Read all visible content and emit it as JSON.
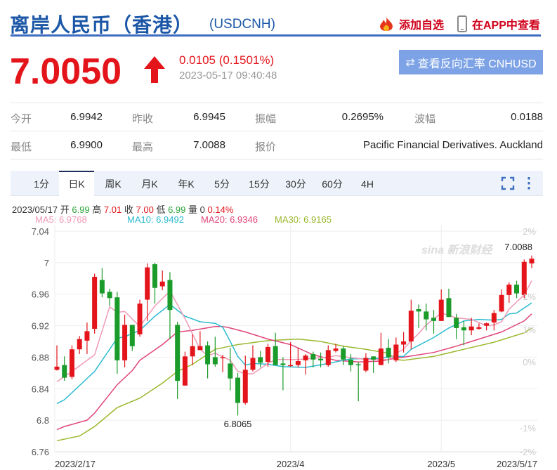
{
  "header": {
    "title": "离岸人民币（香港）",
    "code": "(USDCNH)",
    "add_watch": "添加自选",
    "view_app": "在APP中查看"
  },
  "quote": {
    "price": "7.0050",
    "change": "0.0105 (0.1501%)",
    "time": "2023-05-17 09:40:48",
    "reverse_button": "查看反向汇率 CNHUSD"
  },
  "stats": [
    [
      {
        "label": "今开",
        "value": "6.9942"
      },
      {
        "label": "昨收",
        "value": "6.9945"
      },
      {
        "label": "振幅",
        "value": "0.2695%"
      },
      {
        "label": "波幅",
        "value": "0.0188"
      }
    ],
    [
      {
        "label": "最低",
        "value": "6.9900"
      },
      {
        "label": "最高",
        "value": "7.0088"
      },
      {
        "label": "报价",
        "value": "Pacific Financial Derivatives. Auckland"
      }
    ]
  ],
  "tabs": [
    "1分",
    "日K",
    "周K",
    "月K",
    "年K",
    "5分",
    "15分",
    "30分",
    "60分",
    "4H"
  ],
  "active_tab": "日K",
  "info": {
    "date": "2023/05/17",
    "open_label": "开",
    "open": "6.99",
    "high_label": "高",
    "high": "7.01",
    "close_label": "收",
    "close": "7.00",
    "low_label": "低",
    "low": "6.99",
    "vol_label": "量",
    "vol": "0",
    "pct": "0.14%"
  },
  "ma": {
    "ma5": "MA5: 6.9768",
    "ma10": "MA10: 6.9492",
    "ma20": "MA20: 6.9346",
    "ma30": "MA30: 6.9165"
  },
  "colors": {
    "up": "#e4141b",
    "down": "#1a9b2a",
    "ma5": "#f09ab6",
    "ma10": "#2bbbd0",
    "ma20": "#e0457b",
    "ma30": "#9ab82e"
  },
  "watermark": "sina 新浪财经",
  "chart_data": {
    "type": "candlestick",
    "ylim": [
      6.76,
      7.04
    ],
    "yticks": [
      "7.04",
      "7",
      "6.96",
      "6.92",
      "6.88",
      "6.84",
      "6.8",
      "6.76"
    ],
    "pct_ticks": [
      "2%",
      "1%",
      "1%",
      "0%",
      "-1%",
      "-2%"
    ],
    "xlabels": [
      {
        "idx": 0,
        "label": "2023/2/17"
      },
      {
        "idx": 31,
        "label": "2023/4"
      },
      {
        "idx": 51,
        "label": "2023/5"
      },
      {
        "idx": 63,
        "label": "2023/5/17"
      }
    ],
    "annotations": [
      {
        "idx": 24,
        "price": 6.8065,
        "label": "6.8065"
      },
      {
        "idx": 63,
        "price": 7.0088,
        "label": "7.0088"
      }
    ],
    "ohlc": [
      [
        6.864,
        6.895,
        6.863,
        6.868
      ],
      [
        6.87,
        6.881,
        6.85,
        6.854
      ],
      [
        6.855,
        6.895,
        6.852,
        6.89
      ],
      [
        6.89,
        6.907,
        6.884,
        6.903
      ],
      [
        6.901,
        6.924,
        6.884,
        6.913
      ],
      [
        6.916,
        6.986,
        6.91,
        6.982
      ],
      [
        6.978,
        6.993,
        6.956,
        6.961
      ],
      [
        6.963,
        6.967,
        6.945,
        6.955
      ],
      [
        6.956,
        6.963,
        6.859,
        6.876
      ],
      [
        6.876,
        6.934,
        6.867,
        6.921
      ],
      [
        6.921,
        6.921,
        6.888,
        6.894
      ],
      [
        6.909,
        6.953,
        6.906,
        6.948
      ],
      [
        6.953,
        6.999,
        6.926,
        6.994
      ],
      [
        6.998,
        7.0,
        6.948,
        6.968
      ],
      [
        6.97,
        6.99,
        6.965,
        6.976
      ],
      [
        6.978,
        6.988,
        6.903,
        6.94
      ],
      [
        6.921,
        6.925,
        6.827,
        6.85
      ],
      [
        6.844,
        6.887,
        6.844,
        6.881
      ],
      [
        6.881,
        6.909,
        6.87,
        6.894
      ],
      [
        6.889,
        6.913,
        6.889,
        6.894
      ],
      [
        6.895,
        6.9,
        6.853,
        6.871
      ],
      [
        6.88,
        6.906,
        6.868,
        6.871
      ],
      [
        6.879,
        6.883,
        6.861,
        6.88
      ],
      [
        6.872,
        6.892,
        6.838,
        6.853
      ],
      [
        6.854,
        6.86,
        6.806,
        6.822
      ],
      [
        6.822,
        6.882,
        6.82,
        6.864
      ],
      [
        6.864,
        6.895,
        6.862,
        6.879
      ],
      [
        6.88,
        6.888,
        6.867,
        6.873
      ],
      [
        6.874,
        6.897,
        6.868,
        6.893
      ],
      [
        6.894,
        6.911,
        6.87,
        6.87
      ],
      [
        6.872,
        6.88,
        6.838,
        6.87
      ],
      [
        6.869,
        6.899,
        6.868,
        6.87
      ],
      [
        6.87,
        6.892,
        6.867,
        6.875
      ],
      [
        6.876,
        6.884,
        6.858,
        6.882
      ],
      [
        6.884,
        6.887,
        6.867,
        6.877
      ],
      [
        6.878,
        6.886,
        6.867,
        6.876
      ],
      [
        6.87,
        6.895,
        6.868,
        6.889
      ],
      [
        6.888,
        6.897,
        6.886,
        6.891
      ],
      [
        6.891,
        6.894,
        6.87,
        6.877
      ],
      [
        6.877,
        6.884,
        6.862,
        6.87
      ],
      [
        6.871,
        6.874,
        6.824,
        6.87
      ],
      [
        6.863,
        6.885,
        6.861,
        6.879
      ],
      [
        6.881,
        6.881,
        6.86,
        6.877
      ],
      [
        6.87,
        6.911,
        6.87,
        6.891
      ],
      [
        6.892,
        6.903,
        6.872,
        6.88
      ],
      [
        6.876,
        6.905,
        6.874,
        6.896
      ],
      [
        6.896,
        6.912,
        6.886,
        6.9
      ],
      [
        6.9,
        6.953,
        6.89,
        6.939
      ],
      [
        6.941,
        6.947,
        6.917,
        6.938
      ],
      [
        6.938,
        6.948,
        6.914,
        6.928
      ],
      [
        6.93,
        6.94,
        6.91,
        6.926
      ],
      [
        6.926,
        6.966,
        6.926,
        6.953
      ],
      [
        6.955,
        6.967,
        6.931,
        6.931
      ],
      [
        6.93,
        6.935,
        6.903,
        6.917
      ],
      [
        6.918,
        6.926,
        6.895,
        6.914
      ],
      [
        6.914,
        6.93,
        6.908,
        6.919
      ],
      [
        6.916,
        6.923,
        6.915,
        6.918
      ],
      [
        6.92,
        6.924,
        6.914,
        6.923
      ],
      [
        6.924,
        6.94,
        6.914,
        6.936
      ],
      [
        6.938,
        6.966,
        6.937,
        6.959
      ],
      [
        6.959,
        6.975,
        6.949,
        6.972
      ],
      [
        6.972,
        6.977,
        6.955,
        6.961
      ],
      [
        6.959,
        7.004,
        6.955,
        7.001
      ],
      [
        6.999,
        7.009,
        6.993,
        7.005
      ]
    ],
    "ma_series": {
      "ma5": [
        [
          0,
          6.849
        ],
        [
          2,
          6.862
        ],
        [
          5,
          6.883
        ],
        [
          7,
          6.944
        ],
        [
          8,
          6.937
        ],
        [
          9,
          6.938
        ],
        [
          11,
          6.919
        ],
        [
          13,
          6.945
        ],
        [
          15,
          6.964
        ],
        [
          17,
          6.929
        ],
        [
          19,
          6.89
        ],
        [
          20,
          6.882
        ],
        [
          21,
          6.885
        ],
        [
          23,
          6.876
        ],
        [
          24,
          6.862
        ],
        [
          25,
          6.859
        ],
        [
          26,
          6.859
        ],
        [
          28,
          6.872
        ],
        [
          29,
          6.877
        ],
        [
          32,
          6.877
        ],
        [
          36,
          6.88
        ],
        [
          37,
          6.882
        ],
        [
          41,
          6.877
        ],
        [
          44,
          6.877
        ],
        [
          45,
          6.885
        ],
        [
          46,
          6.89
        ],
        [
          47,
          6.901
        ],
        [
          48,
          6.91
        ],
        [
          49,
          6.921
        ],
        [
          51,
          6.936
        ],
        [
          53,
          6.93
        ],
        [
          55,
          6.928
        ],
        [
          57,
          6.92
        ],
        [
          58,
          6.921
        ],
        [
          59,
          6.925
        ],
        [
          60,
          6.941
        ],
        [
          61,
          6.95
        ],
        [
          62,
          6.959
        ],
        [
          63,
          6.977
        ]
      ],
      "ma10": [
        [
          0,
          6.821
        ],
        [
          1,
          6.826
        ],
        [
          5,
          6.862
        ],
        [
          8,
          6.904
        ],
        [
          9,
          6.906
        ],
        [
          11,
          6.914
        ],
        [
          13,
          6.932
        ],
        [
          15,
          6.947
        ],
        [
          17,
          6.932
        ],
        [
          19,
          6.925
        ],
        [
          21,
          6.923
        ],
        [
          22,
          6.918
        ],
        [
          23,
          6.9
        ],
        [
          24,
          6.881
        ],
        [
          25,
          6.87
        ],
        [
          26,
          6.872
        ],
        [
          28,
          6.871
        ],
        [
          30,
          6.868
        ],
        [
          33,
          6.867
        ],
        [
          36,
          6.872
        ],
        [
          39,
          6.878
        ],
        [
          42,
          6.878
        ],
        [
          45,
          6.881
        ],
        [
          46,
          6.881
        ],
        [
          47,
          6.89
        ],
        [
          50,
          6.905
        ],
        [
          52,
          6.917
        ],
        [
          54,
          6.926
        ],
        [
          56,
          6.928
        ],
        [
          58,
          6.927
        ],
        [
          59,
          6.928
        ],
        [
          60,
          6.935
        ],
        [
          61,
          6.936
        ],
        [
          63,
          6.949
        ]
      ],
      "ma20": [
        [
          0,
          6.788
        ],
        [
          1,
          6.792
        ],
        [
          4,
          6.8
        ],
        [
          5,
          6.809
        ],
        [
          8,
          6.845
        ],
        [
          10,
          6.863
        ],
        [
          11,
          6.876
        ],
        [
          14,
          6.896
        ],
        [
          16,
          6.912
        ],
        [
          18,
          6.914
        ],
        [
          21,
          6.919
        ],
        [
          22,
          6.919
        ],
        [
          23,
          6.917
        ],
        [
          25,
          6.912
        ],
        [
          28,
          6.903
        ],
        [
          31,
          6.896
        ],
        [
          34,
          6.883
        ],
        [
          37,
          6.876
        ],
        [
          40,
          6.874
        ],
        [
          43,
          6.875
        ],
        [
          45,
          6.879
        ],
        [
          46,
          6.88
        ],
        [
          50,
          6.886
        ],
        [
          53,
          6.894
        ],
        [
          56,
          6.903
        ],
        [
          59,
          6.912
        ],
        [
          62,
          6.926
        ],
        [
          63,
          6.935
        ]
      ],
      "ma30": [
        [
          0,
          6.774
        ],
        [
          3,
          6.78
        ],
        [
          5,
          6.792
        ],
        [
          8,
          6.816
        ],
        [
          11,
          6.828
        ],
        [
          14,
          6.847
        ],
        [
          16,
          6.862
        ],
        [
          18,
          6.871
        ],
        [
          21,
          6.89
        ],
        [
          23,
          6.894
        ],
        [
          24,
          6.896
        ],
        [
          28,
          6.901
        ],
        [
          32,
          6.903
        ],
        [
          35,
          6.9
        ],
        [
          38,
          6.894
        ],
        [
          41,
          6.89
        ],
        [
          44,
          6.885
        ],
        [
          45,
          6.877
        ],
        [
          46,
          6.876
        ],
        [
          50,
          6.881
        ],
        [
          54,
          6.89
        ],
        [
          58,
          6.899
        ],
        [
          62,
          6.911
        ],
        [
          63,
          6.917
        ]
      ]
    }
  }
}
